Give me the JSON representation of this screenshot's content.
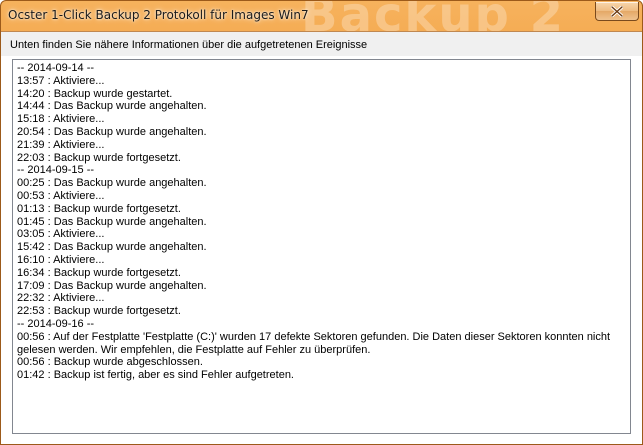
{
  "window": {
    "title": "Ocster 1-Click Backup 2 Protokoll für Images Win7",
    "watermark": "Backup 2",
    "close_label": "close"
  },
  "info": {
    "label": "Unten finden Sie nähere Informationen über die aufgetretenen Ereignisse"
  },
  "log": {
    "lines": [
      "-- 2014-09-14 --",
      "13:57 : Aktiviere...",
      "14:20 : Backup wurde gestartet.",
      "14:44 : Das Backup wurde angehalten.",
      "15:18 : Aktiviere...",
      "20:54 : Das Backup wurde angehalten.",
      "21:39 : Aktiviere...",
      "22:03 : Backup wurde fortgesetzt.",
      "-- 2014-09-15 --",
      "00:25 : Das Backup wurde angehalten.",
      "00:53 : Aktiviere...",
      "01:13 : Backup wurde fortgesetzt.",
      "01:45 : Das Backup wurde angehalten.",
      "03:05 : Aktiviere...",
      "15:42 : Das Backup wurde angehalten.",
      "16:10 : Aktiviere...",
      "16:34 : Backup wurde fortgesetzt.",
      "17:09 : Das Backup wurde angehalten.",
      "22:32 : Aktiviere...",
      "22:53 : Backup wurde fortgesetzt.",
      "-- 2014-09-16 --",
      "00:56 : Auf der Festplatte 'Festplatte (C:)' wurden 17 defekte Sektoren gefunden. Die Daten dieser Sektoren konnten nicht gelesen werden. Wir empfehlen, die Festplatte auf Fehler zu überprüfen.",
      "00:56 : Backup wurde abgeschlossen.",
      "01:42 : Backup ist fertig, aber es sind Fehler aufgetreten."
    ]
  },
  "colors": {
    "titlebar": "#e88b2f",
    "border": "#828790"
  }
}
